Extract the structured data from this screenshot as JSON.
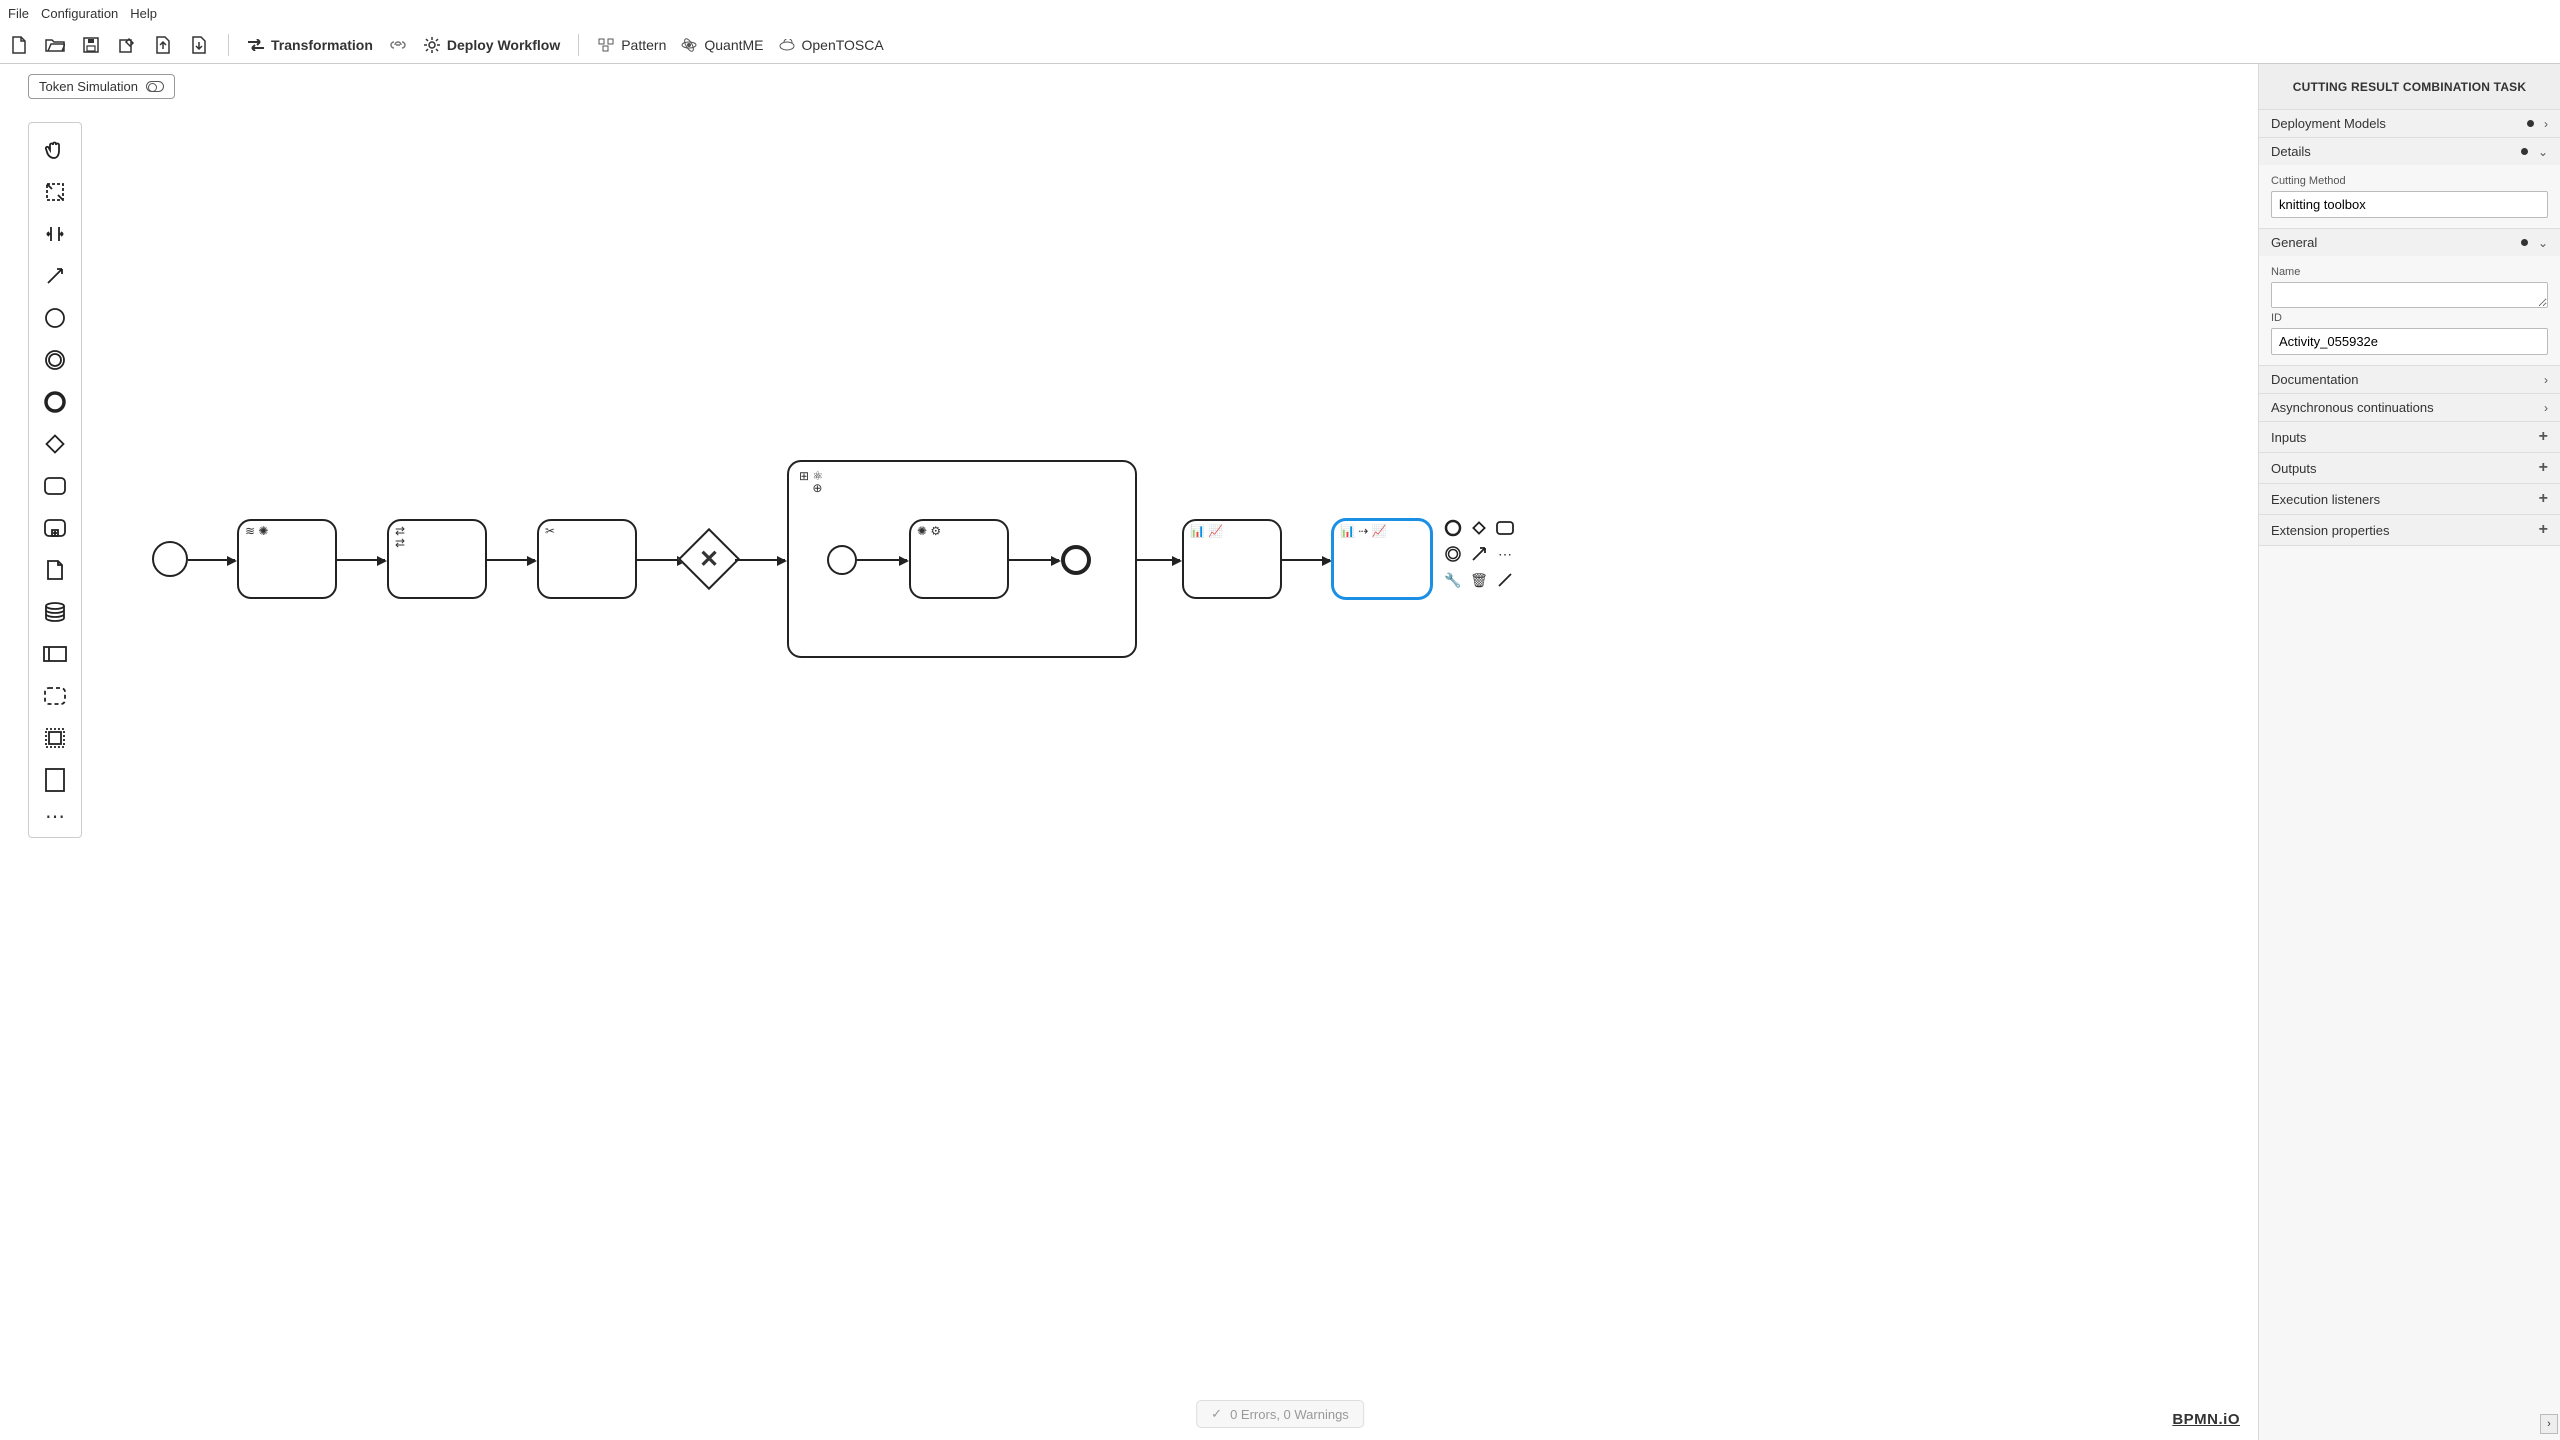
{
  "menu": {
    "file": "File",
    "configuration": "Configuration",
    "help": "Help"
  },
  "toolbar": {
    "new": "new",
    "open": "open",
    "save": "save",
    "edit": "edit",
    "upload": "upload",
    "download": "download",
    "transformation": "Transformation",
    "deploy_workflow": "Deploy Workflow",
    "pattern": "Pattern",
    "quantme": "QuantME",
    "opentosca": "OpenTOSCA"
  },
  "token_sim": {
    "label": "Token Simulation"
  },
  "palette": {
    "hand": "hand",
    "lasso": "lasso",
    "space": "space",
    "connect": "connect",
    "start": "start-event",
    "intermediate": "intermediate-event",
    "end": "end-event",
    "gateway": "gateway",
    "task": "task",
    "subprocess": "subprocess",
    "data_object": "data-object",
    "data_store": "data-store",
    "participant": "participant",
    "group": "group",
    "artifact": "artifact",
    "more": "more"
  },
  "contextpad": {
    "items": [
      "append-end-event",
      "append-gateway",
      "append-task",
      "append-intermediate-event",
      "connect",
      "more",
      "wrench",
      "delete",
      "annotate"
    ]
  },
  "props": {
    "title": "CUTTING RESULT COMBINATION TASK",
    "groups": {
      "deployment": {
        "title": "Deployment Models"
      },
      "details": {
        "title": "Details",
        "cutting_method_label": "Cutting Method",
        "cutting_method_value": "knitting toolbox"
      },
      "general": {
        "title": "General",
        "name_label": "Name",
        "name_value": "",
        "id_label": "ID",
        "id_value": "Activity_055932e"
      },
      "documentation": {
        "title": "Documentation"
      },
      "async": {
        "title": "Asynchronous continuations"
      },
      "inputs": {
        "title": "Inputs"
      },
      "outputs": {
        "title": "Outputs"
      },
      "exec": {
        "title": "Execution listeners"
      },
      "ext": {
        "title": "Extension properties"
      }
    }
  },
  "status": {
    "text": "0 Errors, 0 Warnings"
  },
  "brand": {
    "label": "BPMN.iO"
  }
}
